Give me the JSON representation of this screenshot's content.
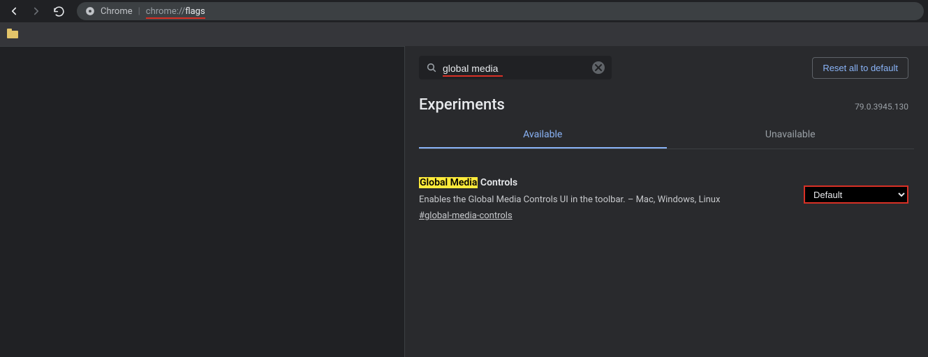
{
  "toolbar": {
    "label": "Chrome",
    "url_prefix": "chrome://",
    "url_bold": "flags"
  },
  "search": {
    "value": "global media"
  },
  "reset_label": "Reset all to default",
  "page_title": "Experiments",
  "version": "79.0.3945.130",
  "tabs": {
    "available": "Available",
    "unavailable": "Unavailable"
  },
  "flag": {
    "title_highlight": "Global Media",
    "title_rest": " Controls",
    "description": "Enables the Global Media Controls UI in the toolbar. – Mac, Windows, Linux",
    "anchor": "#global-media-controls",
    "select_value": "Default"
  }
}
